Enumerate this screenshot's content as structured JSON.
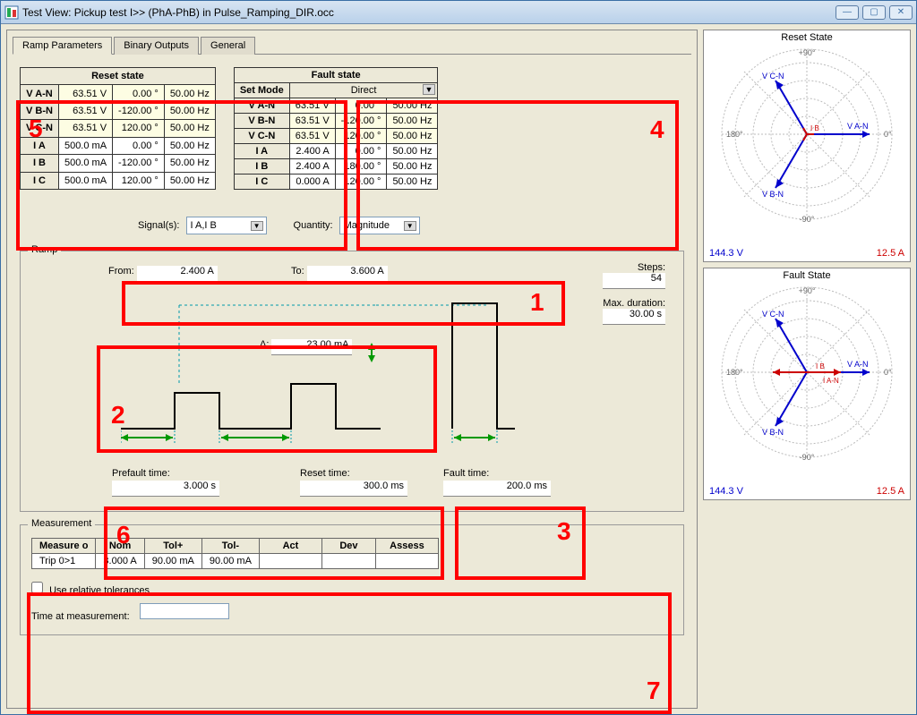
{
  "window": {
    "title": "Test View: Pickup test I>> (PhA-PhB) in Pulse_Ramping_DIR.occ"
  },
  "tabs": {
    "ramp": "Ramp Parameters",
    "binary": "Binary Outputs",
    "general": "General"
  },
  "reset": {
    "header": "Reset state",
    "rows": [
      {
        "name": "V A-N",
        "mag": "63.51 V",
        "ang": "0.00 °",
        "freq": "50.00 Hz",
        "type": "v"
      },
      {
        "name": "V B-N",
        "mag": "63.51 V",
        "ang": "-120.00 °",
        "freq": "50.00 Hz",
        "type": "v"
      },
      {
        "name": "V C-N",
        "mag": "63.51 V",
        "ang": "120.00 °",
        "freq": "50.00 Hz",
        "type": "v"
      },
      {
        "name": "I A",
        "mag": "500.0 mA",
        "ang": "0.00 °",
        "freq": "50.00 Hz",
        "type": "i"
      },
      {
        "name": "I B",
        "mag": "500.0 mA",
        "ang": "-120.00 °",
        "freq": "50.00 Hz",
        "type": "i"
      },
      {
        "name": "I C",
        "mag": "500.0 mA",
        "ang": "120.00 °",
        "freq": "50.00 Hz",
        "type": "i"
      }
    ]
  },
  "fault": {
    "header": "Fault state",
    "setmode_label": "Set Mode",
    "setmode": "Direct",
    "rows": [
      {
        "name": "V A-N",
        "mag": "63.51 V",
        "ang": "0.00 °",
        "freq": "50.00 Hz",
        "type": "v"
      },
      {
        "name": "V B-N",
        "mag": "63.51 V",
        "ang": "-120.00 °",
        "freq": "50.00 Hz",
        "type": "v"
      },
      {
        "name": "V C-N",
        "mag": "63.51 V",
        "ang": "120.00 °",
        "freq": "50.00 Hz",
        "type": "v"
      },
      {
        "name": "I A",
        "mag": "2.400 A",
        "ang": "0.00 °",
        "freq": "50.00 Hz",
        "type": "i"
      },
      {
        "name": "I B",
        "mag": "2.400 A",
        "ang": "180.00 °",
        "freq": "50.00 Hz",
        "type": "i"
      },
      {
        "name": "I C",
        "mag": "0.000 A",
        "ang": "120.00 °",
        "freq": "50.00 Hz",
        "type": "i"
      }
    ]
  },
  "selectors": {
    "signal_label": "Signal(s):",
    "signal_value": "I A,I B",
    "quantity_label": "Quantity:",
    "quantity_value": "Magnitude"
  },
  "ramp": {
    "legend": "Ramp",
    "from_label": "From:",
    "from": "2.400 A",
    "to_label": "To:",
    "to": "3.600 A",
    "delta_label": "Δ:",
    "delta": "23.00 mA",
    "steps_label": "Steps:",
    "steps": "54",
    "maxdur_label": "Max. duration:",
    "maxdur": "30.00 s",
    "prefault_label": "Prefault time:",
    "prefault": "3.000 s",
    "reset_label": "Reset time:",
    "reset": "300.0 ms",
    "fault_label": "Fault time:",
    "fault": "200.0 ms"
  },
  "meas": {
    "legend": "Measurement",
    "headers": [
      "Measure o",
      "Nom",
      "Tol+",
      "Tol-",
      "Act",
      "Dev",
      "Assess"
    ],
    "r0": {
      "name": "Trip 0>1",
      "nom": "3.000 A",
      "tolp": "90.00 mA",
      "tolm": "90.00 mA",
      "act": "",
      "dev": "",
      "assess": ""
    },
    "cb_label": "Use relative tolerances",
    "tam_label": "Time at measurement:"
  },
  "phasor": {
    "reset_title": "Reset State",
    "fault_title": "Fault State",
    "left": "144.3  V",
    "right": "12.5  A",
    "va": "V A-N",
    "vb": "V B-N",
    "vc": "V C-N",
    "ia": "I A-N"
  },
  "callouts": {
    "c1": "1",
    "c2": "2",
    "c3": "3",
    "c4": "4",
    "c5": "5",
    "c6": "6",
    "c7": "7"
  }
}
